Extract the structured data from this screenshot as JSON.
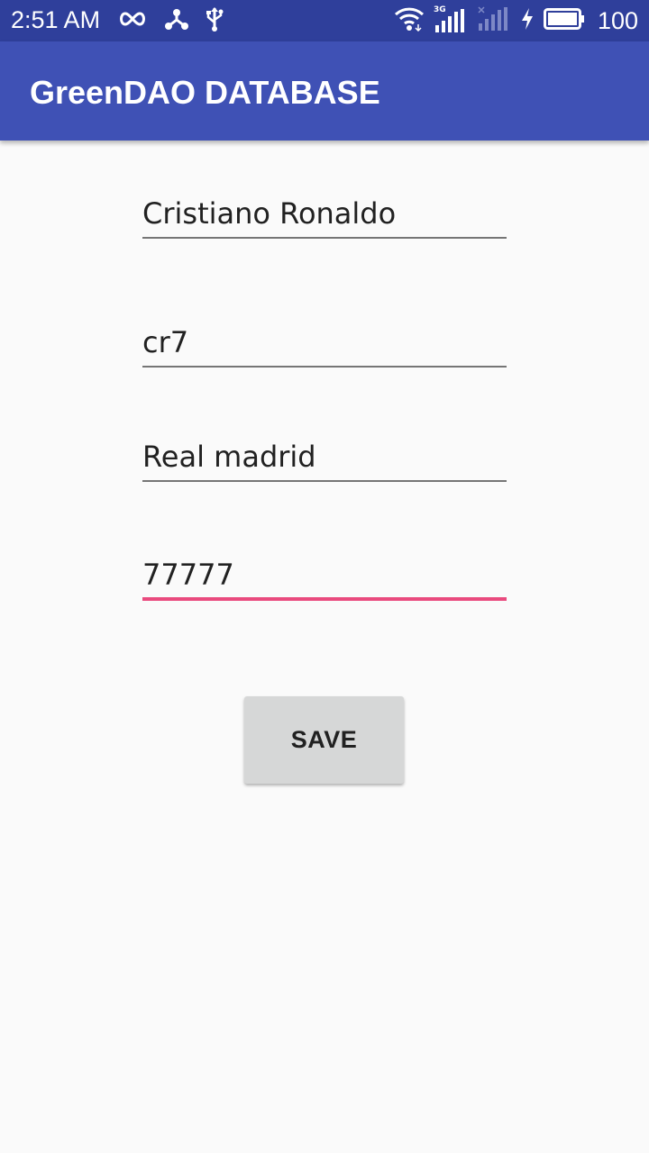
{
  "status_bar": {
    "time": "2:51 AM",
    "battery_level": "100",
    "icons_left": [
      "infinity-icon",
      "share-icon",
      "usb-icon"
    ],
    "icons_right": [
      "wifi-icon",
      "signal-3g-icon",
      "signal-no-sim-icon",
      "charging-icon",
      "battery-icon"
    ],
    "network_label": "3G"
  },
  "app_bar": {
    "title": "GreenDAO DATABASE",
    "background_color": "#3f51b5"
  },
  "form": {
    "fields": [
      {
        "value": "Cristiano Ronaldo",
        "focused": false
      },
      {
        "value": "cr7",
        "focused": false
      },
      {
        "value": "Real madrid",
        "focused": false
      },
      {
        "value": "77777",
        "focused": true
      }
    ],
    "accent_color": "#e94a7e",
    "save_label": "SAVE"
  }
}
